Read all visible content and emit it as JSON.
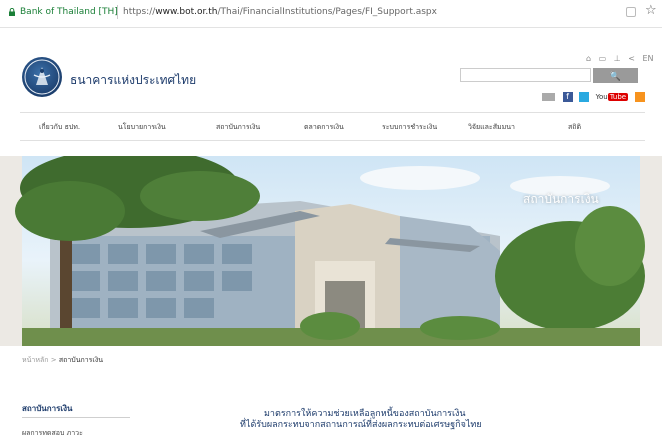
{
  "browser": {
    "site_identity": "Bank of Thailand [TH]",
    "url_prefix": "https://",
    "url_domain": "www.bot.or.th",
    "url_path": "/Thai/FinancialInstitutions/Pages/FI_Support.aspx"
  },
  "header": {
    "bank_name": "ธนาคารแห่งประเทศไทย",
    "top_icons": [
      "home-icon",
      "print-icon",
      "sitemap-icon",
      "share-icon"
    ],
    "lang_link": "EN",
    "search_placeholder": "",
    "search_button_label": "🔍",
    "social": [
      "mail-icon",
      "facebook-icon",
      "twitter-icon",
      "youtube-icon",
      "rss-icon"
    ],
    "youtube_you": "You",
    "youtube_tube": "Tube"
  },
  "nav": {
    "items": [
      "เกี่ยวกับ ธปท.",
      "นโยบายการเงิน",
      "สถาบันการเงิน",
      "ตลาดการเงิน",
      "ระบบการชำระเงิน",
      "วิจัยและสัมมนา",
      "สถิติ"
    ]
  },
  "banner": {
    "title": "สถาบันการเงิน"
  },
  "breadcrumb": {
    "home": "หน้าหลัก",
    "separator": ">",
    "current": "สถาบันการเงิน"
  },
  "sidebar": {
    "title": "สถาบันการเงิน",
    "items": [
      "ผลการทดสอบ ภาวะ"
    ]
  },
  "main": {
    "title_line1": "มาตรการให้ความช่วยเหลือลูกหนี้ของสถาบันการเงิน",
    "title_line2": "ที่ได้รับผลกระทบจากสถานการณ์ที่ส่งผลกระทบต่อเศรษฐกิจไทย"
  },
  "colors": {
    "brand_navy": "#1d3b6b",
    "secure_green": "#1a7f37",
    "search_button": "#9a9a9a"
  }
}
